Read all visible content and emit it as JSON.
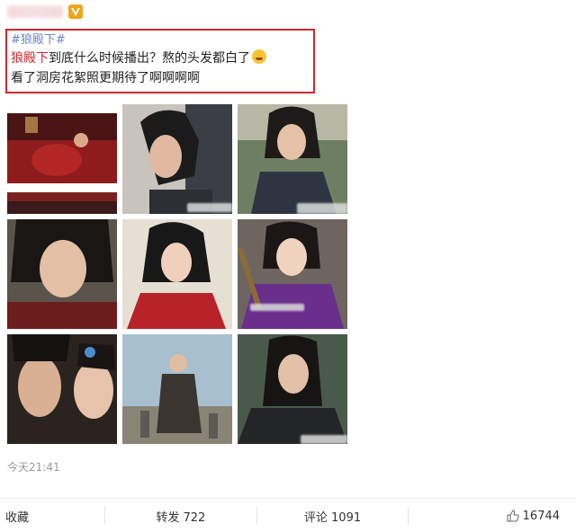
{
  "post": {
    "hashtag": "#狼殿下#",
    "line1_red": "狼殿下",
    "line1_rest": "到底什么时候播出？熬的头发都白了",
    "line2": "看了洞房花絮照更期待了啊啊啊啊",
    "timestamp": "今天21:41"
  },
  "actions": {
    "collect": "收藏",
    "repost": "转发 722",
    "comment": "评论 1091",
    "like": "16744"
  },
  "icons": {
    "vip": "vip-badge-icon",
    "emoji": "crying-face-icon",
    "like": "thumbs-up-icon"
  },
  "colors": {
    "highlight_border": "#d0282f",
    "hashtag": "#6a86c8",
    "vip": "#f0a41c"
  }
}
